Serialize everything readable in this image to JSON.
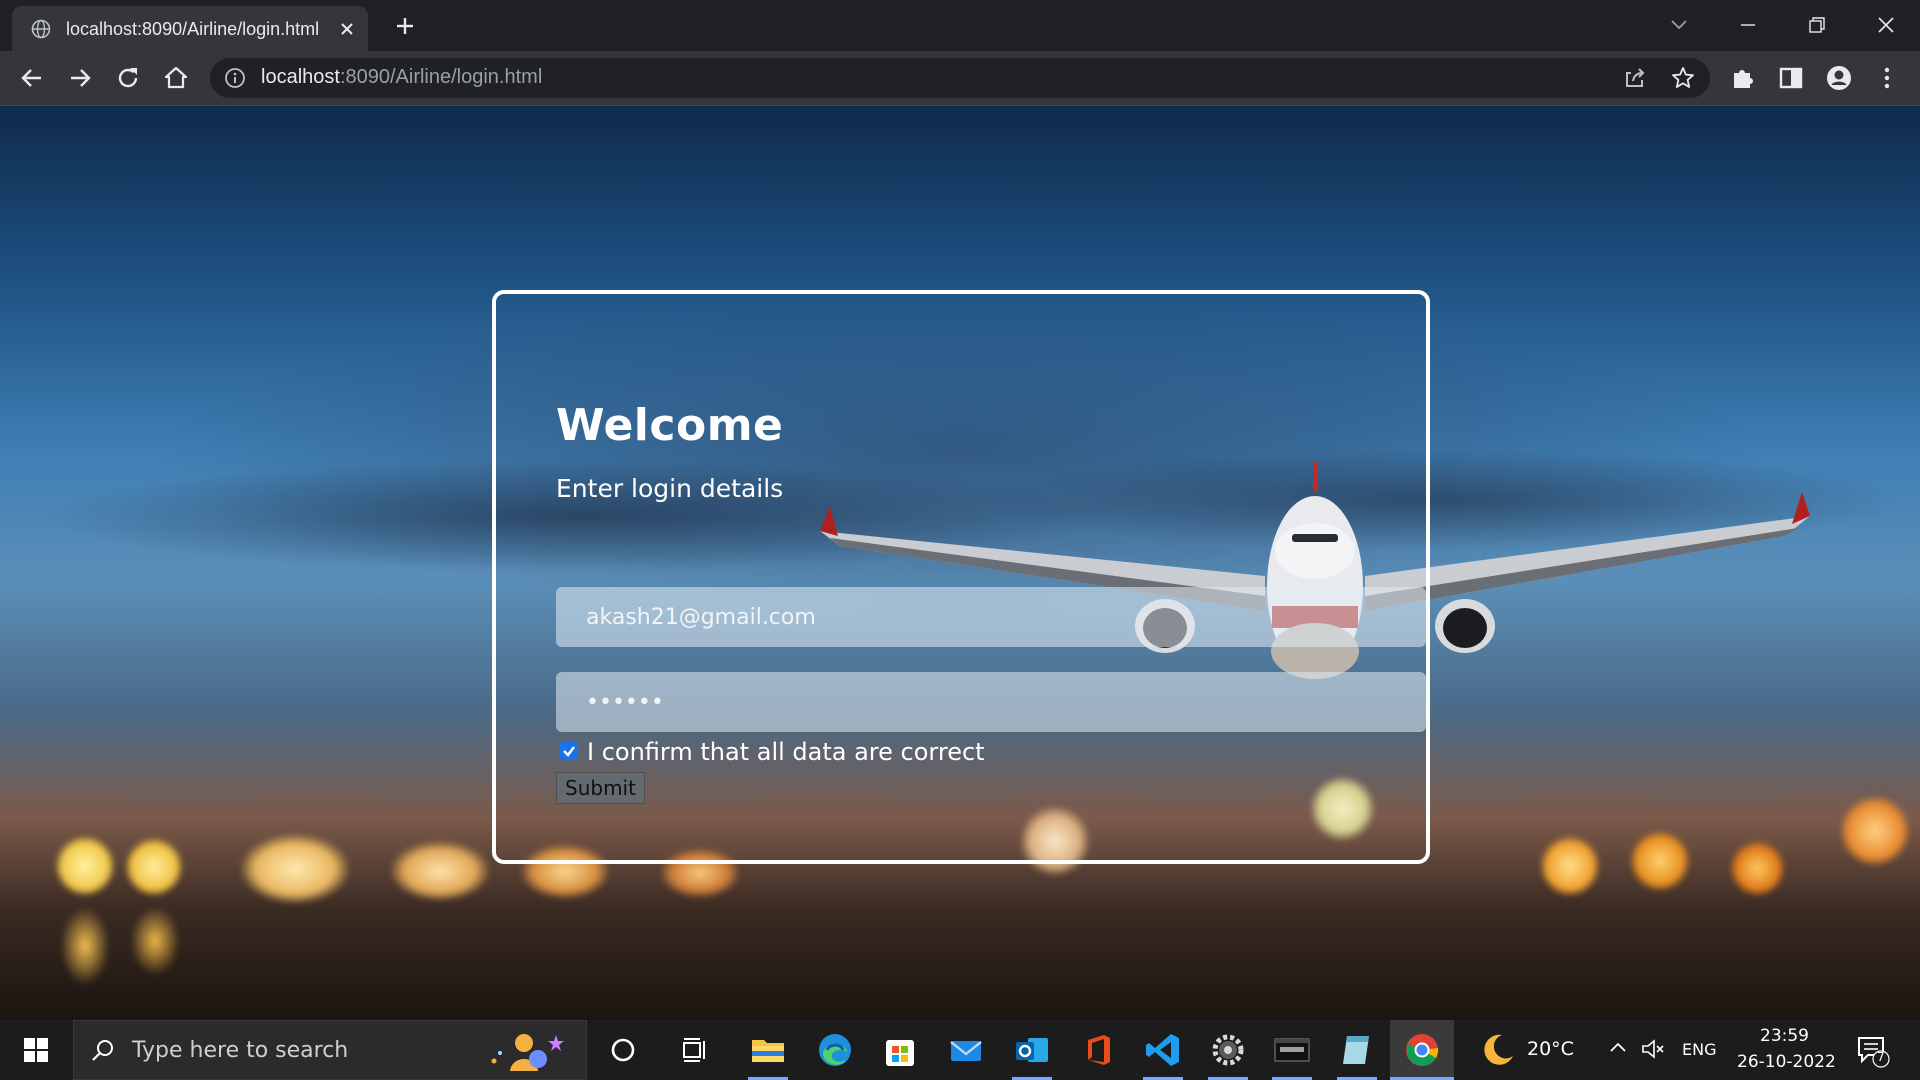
{
  "browser": {
    "tab_title": "localhost:8090/Airline/login.html",
    "url_host": "localhost",
    "url_rest": ":8090/Airline/login.html"
  },
  "login": {
    "title": "Welcome",
    "subtitle": "Enter login details",
    "email_placeholder": "akash21@gmail.com",
    "password_dots": "••••••",
    "confirm_label": "I confirm that all data are correct",
    "confirm_checked": true,
    "submit_label": "Submit"
  },
  "taskbar": {
    "search_placeholder": "Type here to search",
    "weather_temp": "20°C",
    "language": "ENG",
    "time": "23:59",
    "date": "26-10-2022",
    "notification_count": "7",
    "apps": [
      "cortana",
      "task-view",
      "file-explorer",
      "edge",
      "microsoft-store",
      "mail",
      "outlook",
      "office",
      "vscode",
      "settings",
      "mysql",
      "notepad",
      "chrome"
    ]
  },
  "colors": {
    "accent": "#1a73e8",
    "card_border": "#ffffff",
    "chrome_bg": "#202124",
    "toolbar_bg": "#35363a"
  }
}
